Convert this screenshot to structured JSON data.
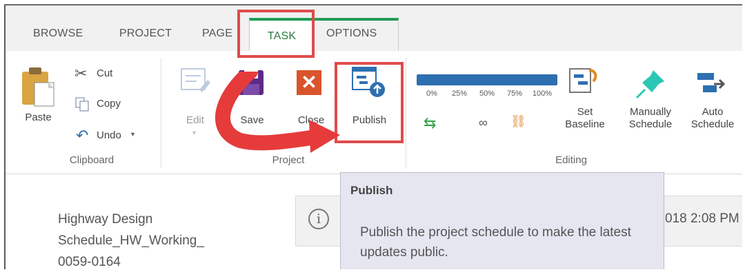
{
  "tabs": [
    {
      "label": "BROWSE"
    },
    {
      "label": "PROJECT"
    },
    {
      "label": "PAGE"
    },
    {
      "label": "TASK"
    },
    {
      "label": "OPTIONS"
    }
  ],
  "clipboard": {
    "paste": "Paste",
    "cut": "Cut",
    "copy": "Copy",
    "undo": "Undo",
    "group": "Clipboard"
  },
  "project": {
    "edit": "Edit",
    "save": "Save",
    "close": "Close",
    "publish": "Publish",
    "group": "Project"
  },
  "editing": {
    "percent": [
      "0%",
      "25%",
      "50%",
      "75%",
      "100%"
    ],
    "set_baseline": "Set\nBaseline",
    "manually_schedule": "Manually\nSchedule",
    "auto_schedule": "Auto\nSchedule",
    "group": "Editing"
  },
  "tooltip": {
    "title": "Publish",
    "body": "Publish the project schedule to make the latest updates public."
  },
  "page": {
    "project_name_lines": [
      "Highway Design",
      "Schedule_HW_Working_",
      "0059-0164"
    ],
    "info_time": "018 2:08 PM"
  },
  "colors": {
    "accent_green": "#1f9d55",
    "highlight_red": "#e04b4b",
    "arrow_red": "#e53b3b",
    "bar_blue": "#2d6fb1"
  }
}
